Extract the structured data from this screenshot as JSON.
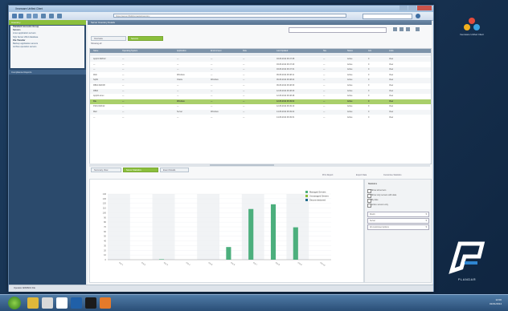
{
  "window": {
    "title": "Xeonware Unified Client",
    "address": "https://server:8443/console/inventory"
  },
  "sidebar": {
    "header": "Inventory",
    "groups": [
      {
        "label": "Standard Accounts Group",
        "heading": true
      },
      {
        "label": "Servers",
        "heading": true
      },
      {
        "label": "Linux application servers"
      },
      {
        "label": "SQL Server 2012 database"
      },
      {
        "label": "File Transfer",
        "heading": true
      },
      {
        "label": "Backup application servers"
      },
      {
        "label": "Archive operation servers"
      }
    ],
    "section2": "Compliance Reports"
  },
  "main": {
    "header": "Server Inventory Details",
    "tabs": [
      "Overview",
      "Servers"
    ],
    "filter_label": "Showing all",
    "columns": [
      "Name",
      "Operating System",
      "Application",
      "Environment",
      "Role",
      "Last Updated",
      "Site",
      "Status",
      "Ack",
      "Links"
    ],
    "rows": [
      {
        "name": "App01-W2K12",
        "os": "—",
        "app": "—",
        "env": "—",
        "role": "—",
        "updated": "03-05-2014 06:47:28",
        "site": "—",
        "status": "Active",
        "ack": "0",
        "link": "View",
        "state": "alt"
      },
      {
        "name": "—",
        "os": "—",
        "app": "—",
        "env": "—",
        "role": "—",
        "updated": "03-05-2014 06:47:29",
        "site": "—",
        "status": "Active",
        "ack": "0",
        "link": "View",
        "state": ""
      },
      {
        "name": "—",
        "os": "—",
        "app": "—",
        "env": "—",
        "role": "—",
        "updated": "03-05-2014 06:47:31",
        "site": "—",
        "status": "Active",
        "ack": "0",
        "link": "View",
        "state": "alt"
      },
      {
        "name": "Web",
        "os": "—",
        "app": "Windows",
        "env": "—",
        "role": "—",
        "updated": "06-05-2014 06:48:11",
        "site": "—",
        "status": "Active",
        "ack": "0",
        "link": "View",
        "state": ""
      },
      {
        "name": "Sql01",
        "os": "—",
        "app": "Oracle",
        "env": "Windows",
        "role": "—",
        "updated": "06-05-2014 06:48:22",
        "site": "—",
        "status": "Active",
        "ack": "0",
        "link": "View",
        "state": "alt"
      },
      {
        "name": "DB01-W2K08",
        "os": "—",
        "app": "—",
        "env": "—",
        "role": "—",
        "updated": "06-05-2014 06:48:30",
        "site": "—",
        "status": "Active",
        "ack": "0",
        "link": "View",
        "state": ""
      },
      {
        "name": "DB02",
        "os": "—",
        "app": "—",
        "env": "—",
        "role": "—",
        "updated": "12-05-2014 06:48:40",
        "site": "—",
        "status": "Active",
        "ack": "0",
        "link": "View",
        "state": "alt"
      },
      {
        "name": "App02-Linux",
        "os": "—",
        "app": "—",
        "env": "—",
        "role": "—",
        "updated": "12-05-2014 06:48:48",
        "site": "—",
        "status": "Active",
        "ack": "0",
        "link": "View",
        "state": ""
      },
      {
        "name": "File",
        "os": "—",
        "app": "Windows",
        "env": "—",
        "role": "—",
        "updated": "12-05-2014 06:49:02",
        "site": "—",
        "status": "Active",
        "ack": "0",
        "link": "View",
        "state": "sel"
      },
      {
        "name": "FS01-W2K12",
        "os": "—",
        "app": "—",
        "env": "—",
        "role": "—",
        "updated": "12-05-2014 06:49:10",
        "site": "—",
        "status": "Active",
        "ack": "0",
        "link": "View",
        "state": ""
      },
      {
        "name": "Mail",
        "os": "—",
        "app": "Server",
        "env": "Windows",
        "role": "—",
        "updated": "14-05-2014 06:49:22",
        "site": "—",
        "status": "Active",
        "ack": "0",
        "link": "View",
        "state": "alt"
      },
      {
        "name": "—",
        "os": "—",
        "app": "—",
        "env": "—",
        "role": "—",
        "updated": "14-05-2014 06:49:31",
        "site": "—",
        "status": "Active",
        "ack": "0",
        "link": "View",
        "state": ""
      }
    ],
    "bottom_tabs": [
      "Summary View",
      "Server Statistics",
      "Event Details"
    ],
    "chart_tools": [
      "Print Report",
      "Export Data",
      "Customise Statistics"
    ]
  },
  "right_panel": {
    "title": "Statistics",
    "options": [
      "Show all servers",
      "Show only servers with data",
      "By date",
      "Active servers only"
    ],
    "dropdowns": [
      "Month",
      "Server",
      "All customised options"
    ]
  },
  "chart_data": {
    "type": "bar",
    "categories": [
      "Cat 1",
      "Cat 2",
      "Cat 3",
      "Cat 4",
      "Cat 5",
      "Cat 6",
      "Cat 7",
      "Cat 8",
      "Cat 9",
      "Cat 10"
    ],
    "series": [
      {
        "name": "Managed Servers",
        "color": "#4caf7d",
        "values": [
          0,
          0,
          1,
          0,
          0,
          27,
          108,
          118,
          69,
          0
        ]
      },
      {
        "name": "Unmanaged Servers",
        "color": "#8bbf3c",
        "values": [
          0,
          0,
          0,
          0,
          0,
          0,
          0,
          0,
          0,
          0
        ]
      },
      {
        "name": "Decommissioned",
        "color": "#1f6b8c",
        "values": [
          0,
          0,
          0,
          0,
          0,
          0,
          0,
          0,
          0,
          0
        ]
      }
    ],
    "ylim": [
      0,
      140
    ],
    "yticks": [
      0,
      10,
      20,
      30,
      40,
      50,
      60,
      70,
      80,
      90,
      100,
      110,
      120,
      130,
      140
    ]
  },
  "statusbar": {
    "text": "Operator ADMIN01 File"
  },
  "taskbar": {
    "time": "12:00",
    "date": "01/01/2014"
  },
  "brand": {
    "top_right": "Xeonware Unified Client",
    "bottom_right": "PLANDAR"
  }
}
